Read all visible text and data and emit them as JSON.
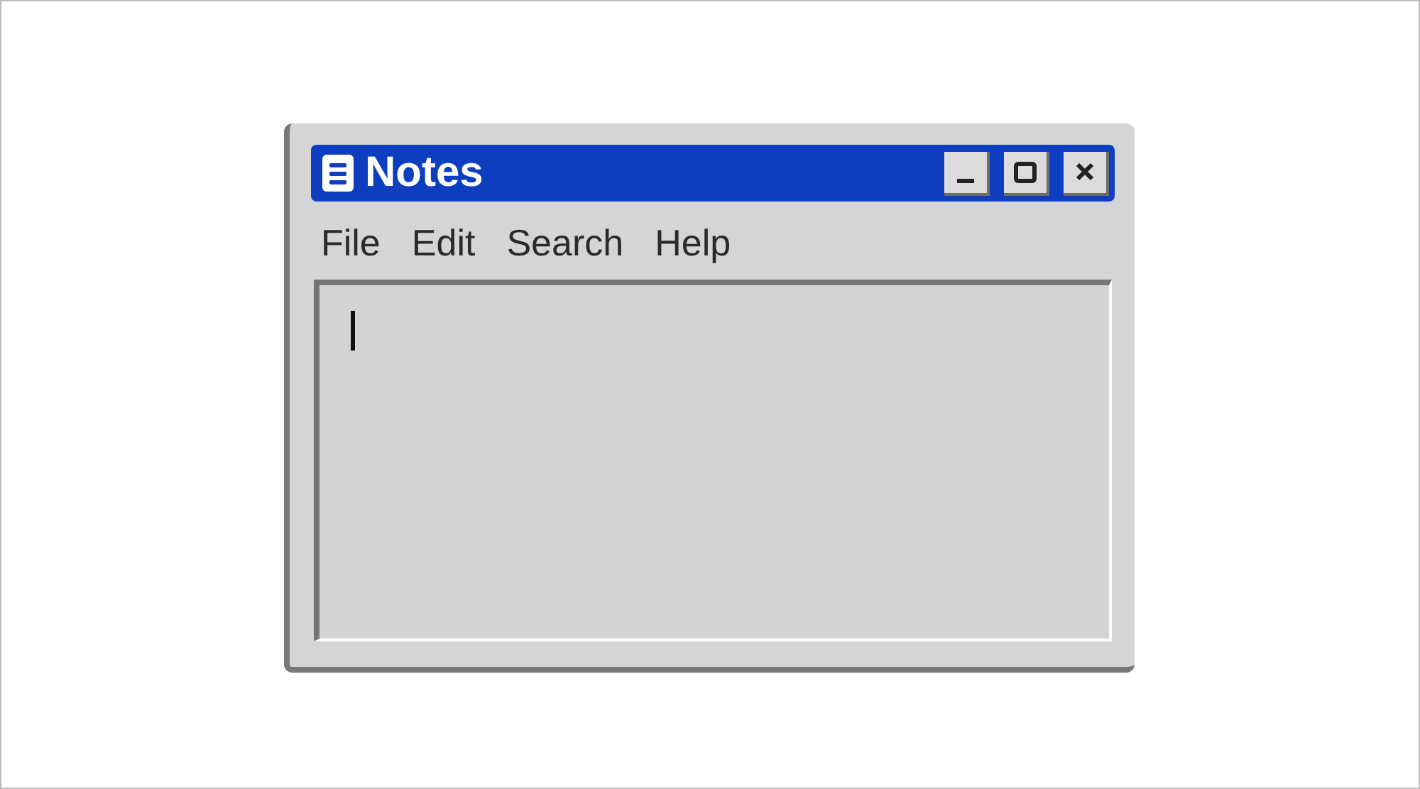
{
  "window": {
    "title": "Notes"
  },
  "menu": [
    {
      "label": "File"
    },
    {
      "label": "Edit"
    },
    {
      "label": "Search"
    },
    {
      "label": "Help"
    }
  ]
}
